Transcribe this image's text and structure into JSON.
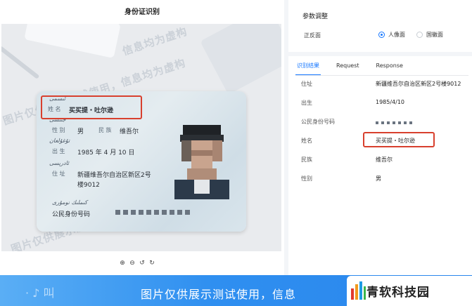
{
  "left_panel": {
    "title": "身份证识别",
    "watermark": "图片仅供展示测试使用，信息均为虚构",
    "watermark_short": "信息均为虚构",
    "watermark_mid": "图片仅供展示测试使用",
    "card": {
      "uy_name": "ئىسمى",
      "name_label": "姓  名",
      "name": "买买提・吐尔逊",
      "uy_gender": "جىنسى",
      "gender_label": "性 别",
      "gender": "男",
      "nation_label": "民 族",
      "nation": "维吾尔",
      "uy_birth": "تۇغۇلغان",
      "birth_label": "出 生",
      "birth": "1985 年  4 月 10 日",
      "uy_address": "ئادرېسى",
      "address_label": "住 址",
      "address_line1": "新疆维吾尔自治区新区2号",
      "address_line2": "楼9012",
      "uy_id": "كىملىك نومۇرى",
      "id_label": "公民身份号码"
    },
    "zoom_tools": [
      "zoom-in-icon",
      "zoom-out-icon",
      "rotate-left-icon",
      "rotate-right-icon"
    ]
  },
  "params": {
    "title": "参数调整",
    "face_label": "正反面",
    "options": [
      {
        "label": "人像面",
        "selected": true
      },
      {
        "label": "国徽面",
        "selected": false
      }
    ],
    "accent_color": "#1677ff"
  },
  "results": {
    "tabs": [
      {
        "label": "识别结果",
        "active": true
      },
      {
        "label": "Request",
        "active": false
      },
      {
        "label": "Response",
        "active": false
      }
    ],
    "rows": [
      {
        "label": "住址",
        "value": "新疆维吾尔自治区新区2号楼9012"
      },
      {
        "label": "出生",
        "value": "1985/4/10"
      },
      {
        "label": "公民身份号码",
        "value": ""
      },
      {
        "label": "姓名",
        "value": "买买提・吐尔逊"
      },
      {
        "label": "民族",
        "value": "维吾尔"
      },
      {
        "label": "性别",
        "value": "男"
      }
    ],
    "highlight_color": "#d8402e"
  },
  "banner": {
    "text": "图片仅供展示测试使用，信息",
    "faint": "· ♪ 叫"
  },
  "brand": {
    "name": "青软科技园"
  }
}
